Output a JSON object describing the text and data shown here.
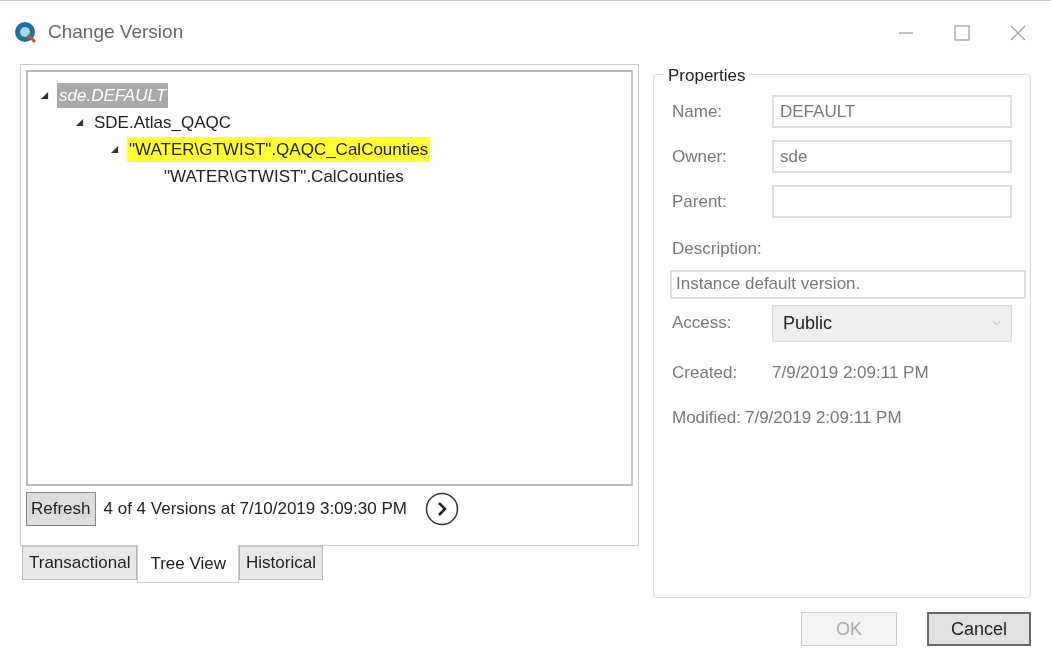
{
  "window": {
    "title": "Change Version"
  },
  "tree": [
    {
      "label": "sde.DEFAULT",
      "selected": true,
      "highlighted": false,
      "expanded": true,
      "children": [
        {
          "label": "SDE.Atlas_QAQC",
          "selected": false,
          "highlighted": false,
          "expanded": true,
          "children": [
            {
              "label": "\"WATER\\GTWIST\".QAQC_CalCounties",
              "selected": false,
              "highlighted": true,
              "expanded": true,
              "children": [
                {
                  "label": "\"WATER\\GTWIST\".CalCounties",
                  "selected": false,
                  "highlighted": false
                }
              ]
            }
          ]
        }
      ]
    }
  ],
  "refresh_button": "Refresh",
  "status": "4 of 4 Versions at 7/10/2019 3:09:30 PM",
  "tabs": [
    {
      "label": "Transactional",
      "selected": false
    },
    {
      "label": "Tree View",
      "selected": true
    },
    {
      "label": "Historical",
      "selected": false
    }
  ],
  "properties": {
    "title": "Properties",
    "name": {
      "label": "Name:",
      "value": "DEFAULT"
    },
    "owner": {
      "label": "Owner:",
      "value": "sde"
    },
    "parent": {
      "label": "Parent:"
    },
    "description": {
      "label": "Description:",
      "value": "Instance default version."
    },
    "access": {
      "label": "Access:",
      "value": "Public"
    },
    "created": {
      "label": "Created:",
      "value": "7/9/2019 2:09:11 PM"
    },
    "modified": {
      "label": "Modified:",
      "value": "7/9/2019 2:09:11 PM"
    }
  },
  "buttons": [
    {
      "label": "OK",
      "disabled": true
    },
    {
      "label": "Cancel",
      "disabled": false
    }
  ]
}
